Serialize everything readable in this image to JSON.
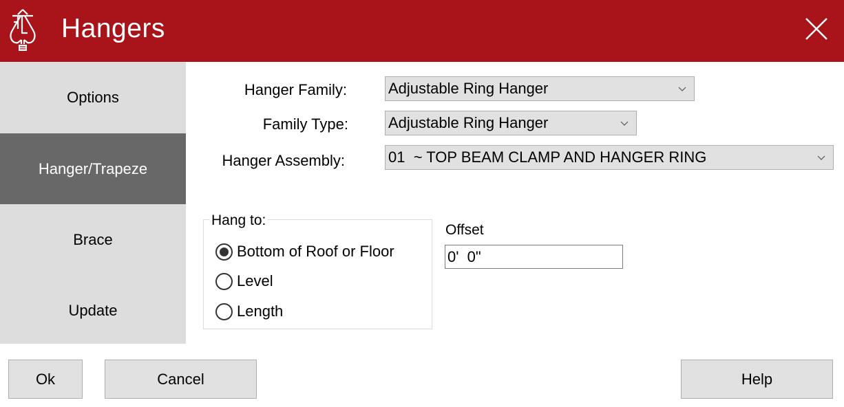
{
  "window": {
    "title": "Hangers",
    "logo_icon": "sprinkler-logo-icon",
    "close_icon": "close-icon",
    "accent_color": "#a8141a"
  },
  "sidebar": {
    "items": [
      {
        "label": "Options",
        "active": false
      },
      {
        "label": "Hanger/Trapeze",
        "active": true
      },
      {
        "label": "Brace",
        "active": false
      },
      {
        "label": "Update",
        "active": false
      }
    ]
  },
  "form": {
    "hanger_family": {
      "label": "Hanger Family:",
      "value": "Adjustable Ring Hanger"
    },
    "family_type": {
      "label": "Family Type:",
      "value": "Adjustable Ring Hanger"
    },
    "hanger_assembly": {
      "label": "Hanger Assembly:",
      "value": "01  ~ TOP BEAM CLAMP AND HANGER RING"
    }
  },
  "hang_to": {
    "legend": "Hang to:",
    "options": [
      {
        "label": "Bottom of Roof or Floor",
        "selected": true
      },
      {
        "label": "Level",
        "selected": false
      },
      {
        "label": "Length",
        "selected": false
      }
    ]
  },
  "offset": {
    "label": "Offset",
    "value": "0'  0\""
  },
  "buttons": {
    "ok": "Ok",
    "cancel": "Cancel",
    "help": "Help"
  }
}
